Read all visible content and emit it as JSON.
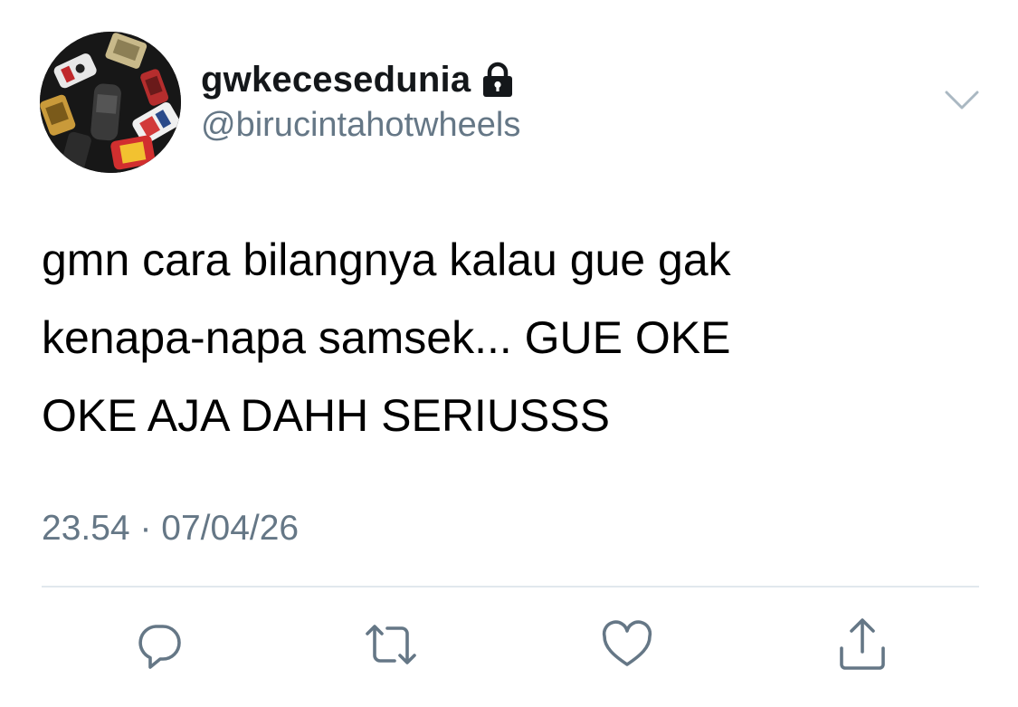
{
  "user": {
    "display_name": "gwkecesedunia",
    "handle": "@birucintahotwheels",
    "protected": true,
    "avatar": "hot-wheels-cars-avatar"
  },
  "tweet": {
    "text_lines": [
      "gmn cara bilangnya kalau gue gak",
      "kenapa-napa samsek... GUE OKE",
      "OKE AJA DAHH SERIUSSS"
    ],
    "time": "23.54",
    "separator": "·",
    "date": "07/04/26"
  },
  "actions": [
    {
      "name": "reply",
      "icon": "reply-icon"
    },
    {
      "name": "retweet",
      "icon": "retweet-icon"
    },
    {
      "name": "like",
      "icon": "heart-icon"
    },
    {
      "name": "share",
      "icon": "share-icon"
    }
  ],
  "colors": {
    "text": "#000000",
    "name": "#14171a",
    "secondary": "#657786",
    "divider": "#e1e8ed",
    "icon": "#657786"
  }
}
